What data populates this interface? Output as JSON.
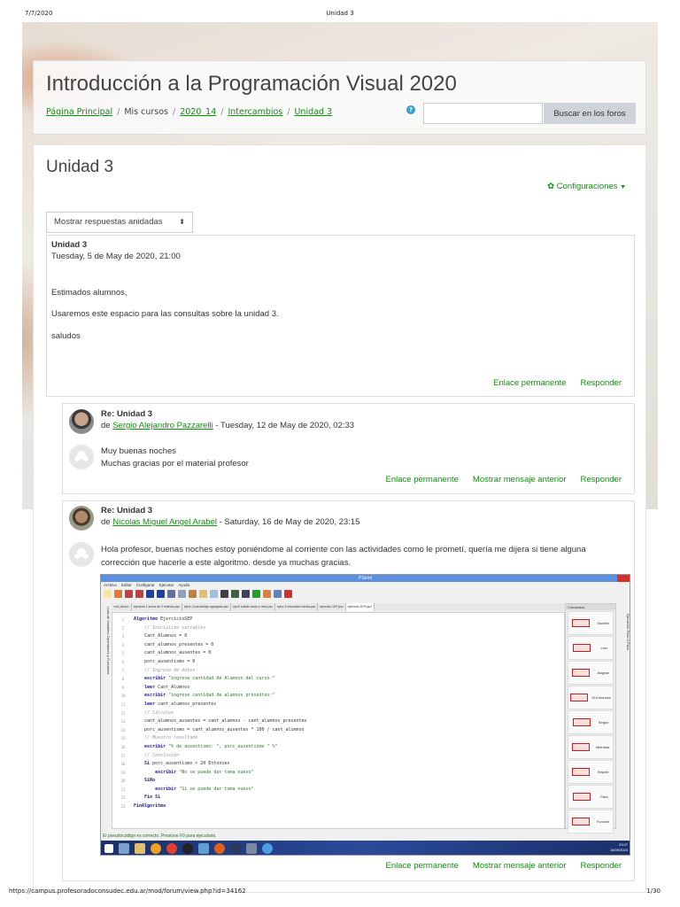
{
  "print_header": {
    "date": "7/7/2020",
    "title": "Unidad 3"
  },
  "header": {
    "course_title": "Introducción a la Programación Visual 2020",
    "breadcrumb": [
      "Página Principal",
      "Mis cursos",
      "2020_14",
      "Intercambios",
      "Unidad 3"
    ],
    "search_placeholder": "",
    "search_button": "Buscar en los foros"
  },
  "page": {
    "title": "Unidad 3",
    "settings_label": "Configuraciones",
    "display_mode": "Mostrar respuestas anidadas"
  },
  "posts": [
    {
      "subject": "Unidad 3",
      "date": "Tuesday, 5 de May de 2020, 21:00",
      "body": [
        "Estimados alumnos,",
        "Usaremos este espacio para las consultas sobre la unidad 3.",
        "saludos"
      ],
      "actions": [
        "Enlace permanente",
        "Responder"
      ]
    },
    {
      "subject": "Re: Unidad 3",
      "by": "de",
      "author": "Sergio Alejandro Pazzarelli",
      "date": " - Tuesday, 12 de May de 2020, 02:33",
      "body": [
        "Muy buenas noches",
        "Muchas gracias por el material profesor"
      ],
      "actions": [
        "Enlace permanente",
        "Mostrar mensaje anterior",
        "Responder"
      ]
    },
    {
      "subject": "Re: Unidad 3",
      "by": "de",
      "author": "Nicolas Miguel Angel Arabel",
      "date": " - Saturday, 16 de May de 2020, 23:15",
      "body": [
        "Hola profesor, buenas noches estoy poniéndome al corriente con las actividades como le prometí, quería me dijera si tiene alguna corrección que hacerle a este algoritmo. desde ya muchas gracias."
      ],
      "actions": [
        "Enlace permanente",
        "Mostrar mensaje anterior",
        "Responder"
      ]
    }
  ],
  "pseint": {
    "title": "PSeInt",
    "menu": [
      "Archivo",
      "Editar",
      "Configurar",
      "Ejecutar",
      "Ayuda"
    ],
    "tabs": [
      "<sin_titulo>",
      "ejercicio 1 suma de 2 enteros.psc",
      "ejerc 2 porcentaje agregado.psc",
      "ejer3 sueldo bruto y neto.psc",
      "ejerc 4 velocidad media.psc",
      "ejercicio 1EP.psc",
      "ejercicio 2EP.psc*"
    ],
    "left_panel": "Lista de Variables   Operadores y Funciones",
    "right_panel": "Ejecución Paso a Paso",
    "commands_title": "Comandos",
    "commands": [
      "Escribir",
      "Leer",
      "Asignar",
      "Si-Entonces",
      "Según",
      "Mientras",
      "Repetir",
      "Para",
      "Función"
    ],
    "code": [
      [
        "k",
        "Algoritmo ",
        "EjercicioSEP"
      ],
      [
        "c",
        "    // Inicializo variables"
      ],
      [
        "n",
        "    Cant_Alumnos = 0"
      ],
      [
        "n",
        "    cant_alumnos_presentes = 0"
      ],
      [
        "n",
        "    cant_alumnos_ausentes = 0"
      ],
      [
        "n",
        "    porc_ausentismo = 0"
      ],
      [
        "c",
        "    // Ingreso de datos"
      ],
      [
        "s",
        "    escribir ",
        "\"ingrese cantidad de Alumnos del curso:\""
      ],
      [
        "k",
        "    leer ",
        "Cant_Alumnos"
      ],
      [
        "s",
        "    escribir ",
        "\"ingrese cantidad de alumnos presentes:\""
      ],
      [
        "k",
        "    leer ",
        "cant_alumnos_presentes"
      ],
      [
        "c",
        "    // Cálculos"
      ],
      [
        "n",
        "    cant_alumnos_ausentes = cant_alumnos - cant_alumnos_presentes"
      ],
      [
        "n",
        "    porc_ausentismo = cant_alumnos_ausentes * 100 / cant_alumnos"
      ],
      [
        "c",
        "    // Muestro resultado"
      ],
      [
        "s",
        "    escribir ",
        "\"% de ausentismo: \", porc_ausentismo \" %\""
      ],
      [
        "c",
        "    // Conclusión"
      ],
      [
        "k",
        "    Si ",
        "porc_ausentismo > 20 Entonces"
      ],
      [
        "s",
        "        escribir ",
        "\"No se puede dar toma nuevo\""
      ],
      [
        "k",
        "    SiNo",
        ""
      ],
      [
        "s",
        "        escribir ",
        "\"Si se puede dar toma nuevo\""
      ],
      [
        "k",
        "    Fin Si",
        ""
      ],
      [
        "k",
        "FinAlgoritmo",
        ""
      ]
    ],
    "status": "El pseudocódigo es correcto. Presione F9 para ejecutarlo.",
    "clock_time": "23:07",
    "clock_date": "16/05/2020"
  },
  "print_footer": {
    "url": "https://campus.profesoradoconsudec.edu.ar/mod/forum/view.php?id=34162",
    "page": "1/30"
  },
  "colors": {
    "link": "#128e12",
    "search_button": "#ced4da"
  }
}
